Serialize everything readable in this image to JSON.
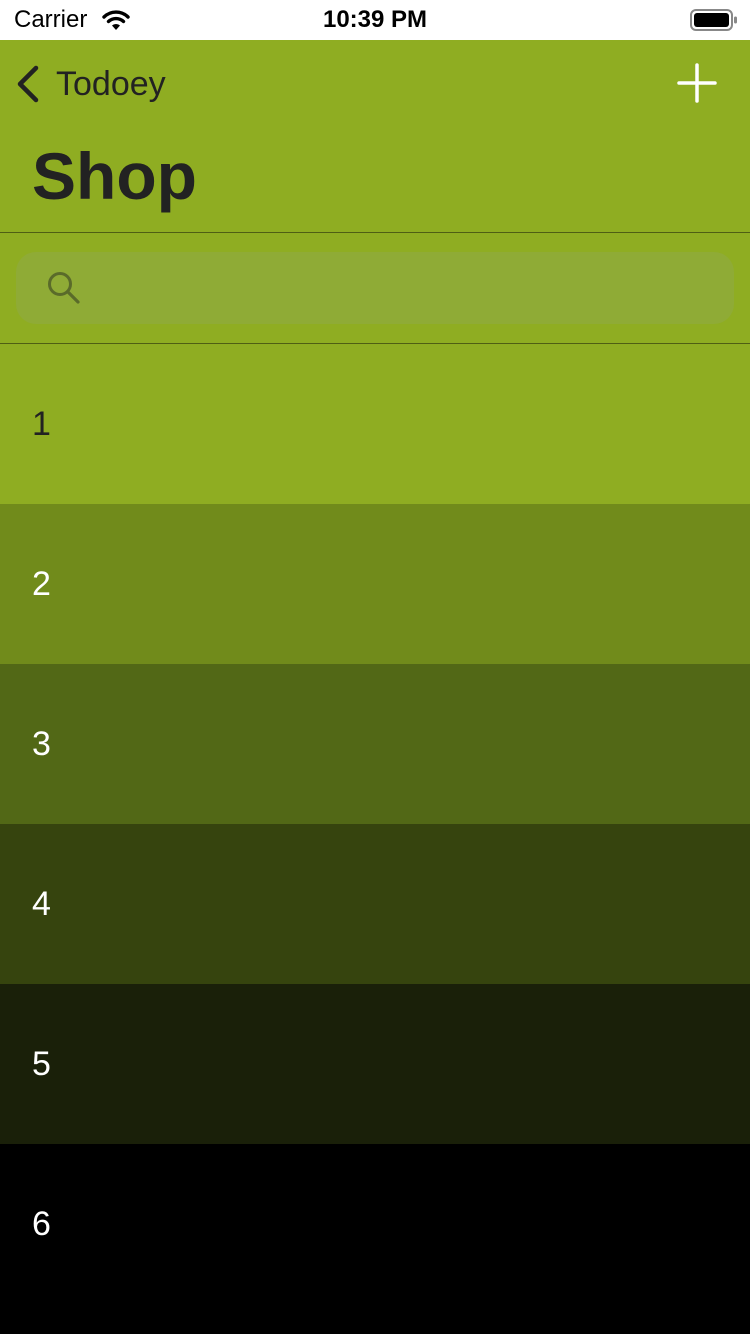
{
  "status_bar": {
    "carrier": "Carrier",
    "time": "10:39 PM",
    "wifi_icon": "wifi-icon",
    "battery_icon": "battery-full-icon"
  },
  "nav": {
    "back_label": "Todoey",
    "back_icon": "chevron-left-icon",
    "add_icon": "plus-icon",
    "title": "Shop",
    "background": "#8fad22"
  },
  "search": {
    "placeholder": "",
    "value": "",
    "icon": "search-icon"
  },
  "items": [
    {
      "label": "1",
      "color": "#8fad22"
    },
    {
      "label": "2",
      "color": "#718b1b"
    },
    {
      "label": "3",
      "color": "#526816"
    },
    {
      "label": "4",
      "color": "#36440e"
    },
    {
      "label": "5",
      "color": "#1a2009"
    },
    {
      "label": "6",
      "color": "#000000"
    }
  ]
}
